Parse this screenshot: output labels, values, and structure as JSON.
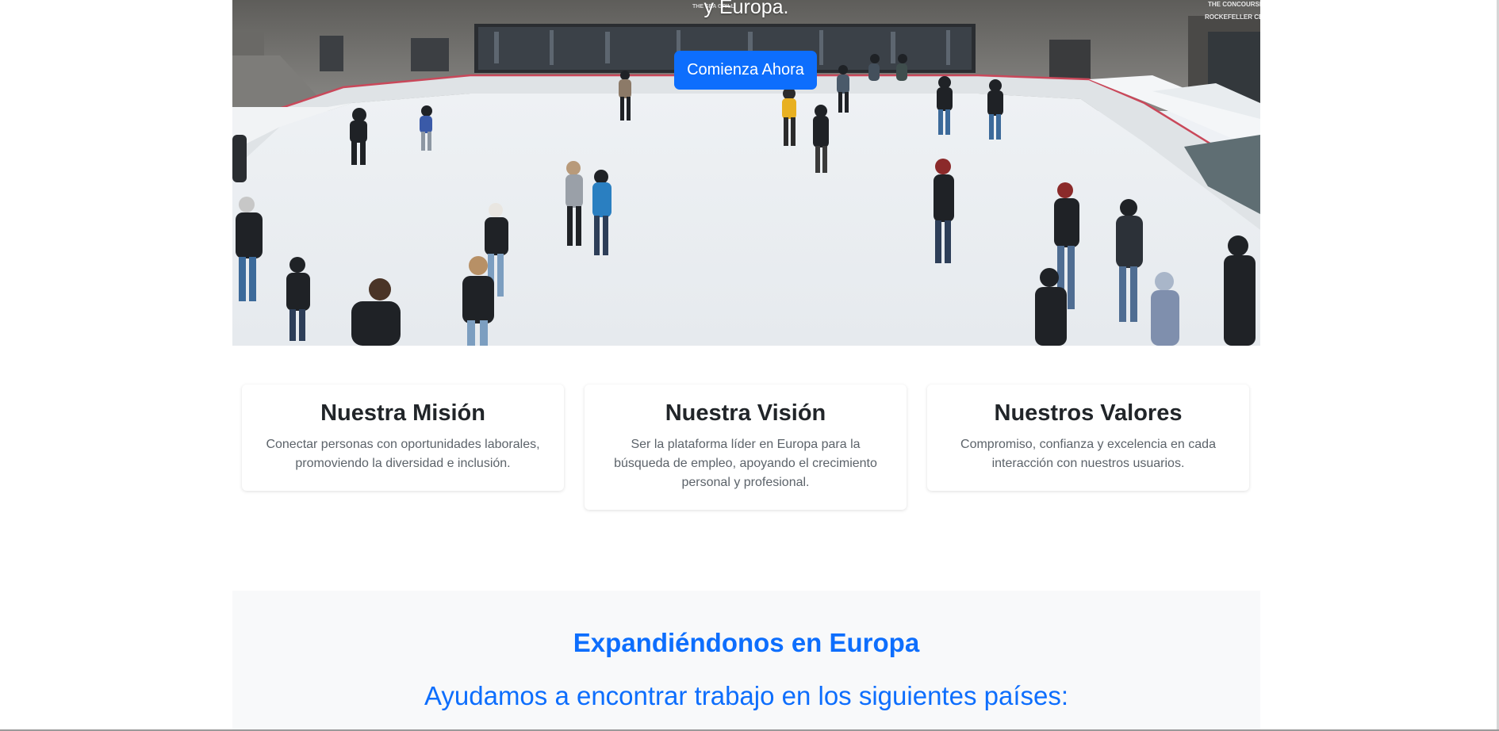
{
  "hero": {
    "subtitle": "y Europa.",
    "cta_label": "Comienza Ahora",
    "image_alt": "Pista de patinaje sobre hielo",
    "sign_text_left": "THE SEA GRILL",
    "sign_text_right_1": "THE CONCOURSE",
    "sign_text_right_2": "ROCKEFELLER CENTER"
  },
  "cards": [
    {
      "title": "Nuestra Misión",
      "text": "Conectar personas con oportunidades laborales, promoviendo la diversidad e inclusión."
    },
    {
      "title": "Nuestra Visión",
      "text": "Ser la plataforma líder en Europa para la búsqueda de empleo, apoyando el crecimiento personal y profesional."
    },
    {
      "title": "Nuestros Valores",
      "text": "Compromiso, confianza y excelencia en cada interacción con nuestros usuarios."
    }
  ],
  "expand": {
    "title": "Expandiéndonos en Europa",
    "subtitle": "Ayudamos a encontrar trabajo en los siguientes países:"
  },
  "colors": {
    "primary": "#0d6efd",
    "heading": "#212529",
    "muted": "#5c636a",
    "section_bg": "#f8f9fa"
  }
}
